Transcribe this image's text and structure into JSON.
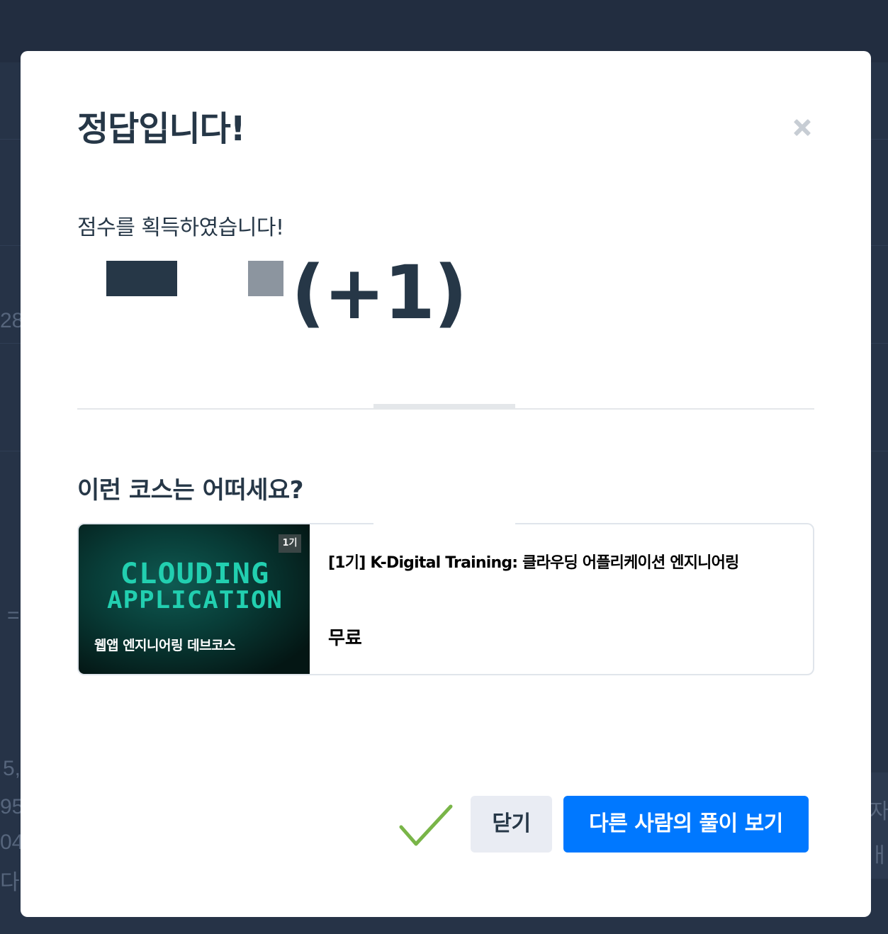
{
  "background": {
    "fragments": [
      "28",
      "=",
      "5,",
      "95",
      "04",
      "다.",
      "자",
      "ㅐ"
    ]
  },
  "modal": {
    "title": "정답입니다!",
    "close_icon": "close-icon",
    "score_message": "점수를 획득하였습니다!",
    "score_gain": "(+1)",
    "recommend_title": "이런 코스는 어떠세요?"
  },
  "course": {
    "badge": "1기",
    "thumb_line1": "CLOUDING",
    "thumb_line2": "APPLICATION",
    "thumb_subtitle": "웹앱 엔지니어링 데브코스",
    "name": "[1기] K-Digital Training: 클라우딩 어플리케이션 엔지니어링",
    "price": "무료"
  },
  "footer": {
    "check_icon": "check-icon",
    "close_label": "닫기",
    "others_label": "다른 사람의 풀이 보기"
  },
  "colors": {
    "primary": "#0078ff",
    "text": "#263747",
    "check": "#79b548",
    "overlay": "#263347"
  }
}
